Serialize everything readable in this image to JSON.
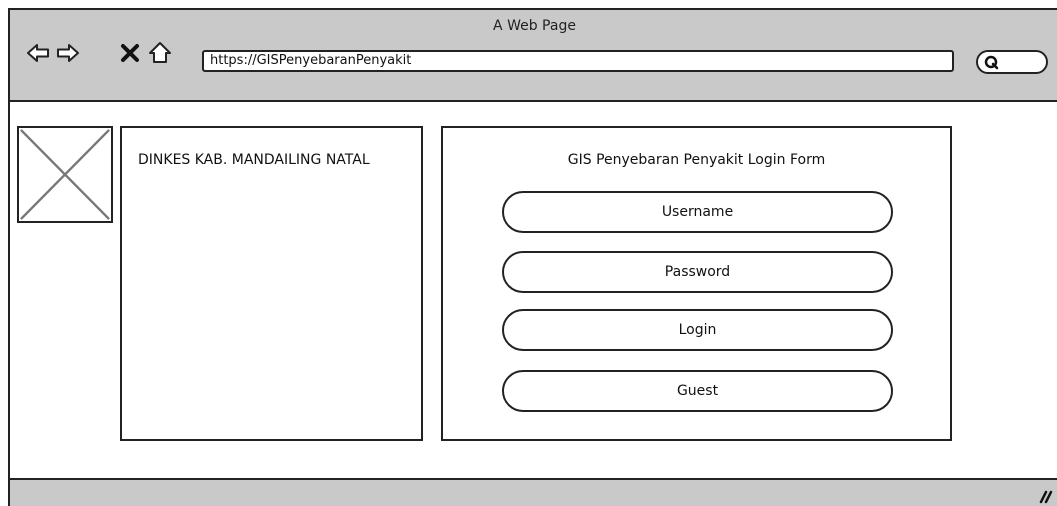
{
  "browser": {
    "page_title": "A Web Page",
    "url": "https://GISPenyebaranPenyakit",
    "nav_icons": [
      "back-icon",
      "forward-icon",
      "close-icon",
      "home-icon"
    ],
    "search_icon": "search-icon"
  },
  "sidebar": {
    "logo_placeholder_icon": "image-placeholder-icon",
    "title": "DINKES KAB. MANDAILING NATAL"
  },
  "login_form": {
    "title": "GIS Penyebaran Penyakit Login Form",
    "username_label": "Username",
    "password_label": "Password",
    "login_button": "Login",
    "guest_button": "Guest"
  },
  "colors": {
    "chrome": "#c9c9c9",
    "outline": "#222222",
    "background": "#ffffff"
  }
}
